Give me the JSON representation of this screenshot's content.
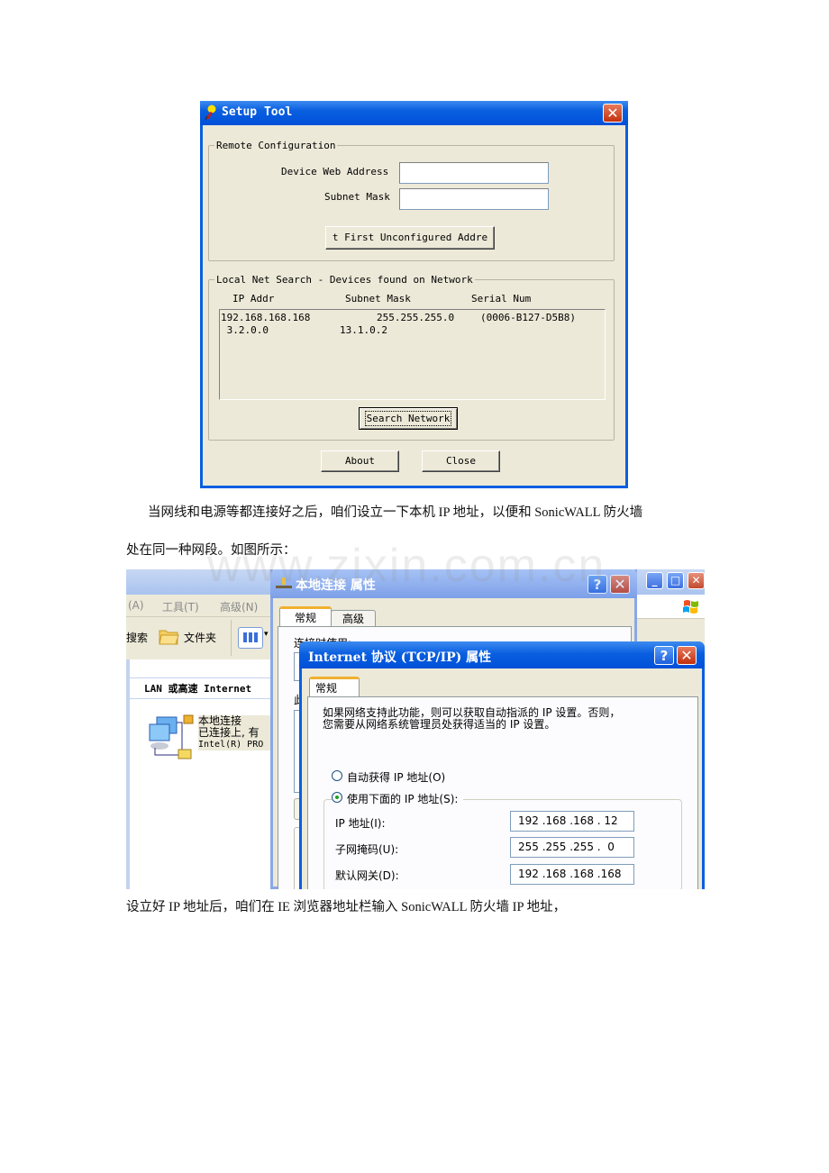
{
  "setup_tool": {
    "title": "Setup Tool",
    "close_glyph": "✕",
    "remote_config": {
      "legend": "Remote Configuration",
      "device_web_address_label": "Device Web Address",
      "device_web_address_value": "",
      "subnet_mask_label": "Subnet Mask",
      "subnet_mask_value": "",
      "first_unconfigured_button": "t First Unconfigured Addre"
    },
    "local_search": {
      "legend": "Local Net Search - Devices found on Network",
      "columns": [
        "IP Addr",
        "Subnet Mask",
        "Serial Num"
      ],
      "rows": [
        {
          "ip": "192.168.168.168",
          "mask": "255.255.255.0",
          "serial": "(0006-B127-D5B8)"
        },
        {
          "ip": " 3.2.0.0",
          "mask": "13.1.0.2",
          "serial": ""
        }
      ],
      "search_button": "Search Network"
    },
    "about_button": "About",
    "close_button": "Close"
  },
  "paragraph1_line1": "当网线和电源等都连接好之后，咱们设立一下本机 IP 地址，以便和 SonicWALL 防火墙",
  "paragraph1_line2": "处在同一种网段。如图所示：",
  "watermark": "www.zixin.com.cn",
  "explorer": {
    "menu": [
      "(A)",
      "工具(T)",
      "高级(N)"
    ],
    "toolbar": [
      "搜索",
      "文件夹"
    ],
    "section_header": "LAN 或高速 Internet",
    "connection": {
      "name": "本地连接",
      "status": "已连接上, 有",
      "device": "Intel(R) PRO"
    }
  },
  "local_conn_dialog": {
    "title": "本地连接 属性",
    "tabs": [
      "常规",
      "高级"
    ],
    "connect_using_label": "连接时使用:",
    "partial_label": "此"
  },
  "tcpip_dialog": {
    "title": "Internet 协议 (TCP/IP) 属性",
    "tab": "常规",
    "description_line1": "如果网络支持此功能，则可以获取自动指派的 IP 设置。否则，",
    "description_line2": "您需要从网络系统管理员处获得适当的 IP 设置。",
    "radio_auto": "自动获得 IP 地址(O)",
    "radio_auto_selected": false,
    "radio_manual": "使用下面的 IP 地址(S):",
    "radio_manual_selected": true,
    "fields": [
      {
        "label": "IP 地址(I):",
        "value": "192 .168 .168 . 12"
      },
      {
        "label": "子网掩码(U):",
        "value": "255 .255 .255 .  0"
      },
      {
        "label": "默认网关(D):",
        "value": "192 .168 .168 .168"
      }
    ]
  },
  "paragraph2": "设立好 IP 地址后，咱们在 IE 浏览器地址栏输入 SonicWALL 防火墙 IP 地址，"
}
